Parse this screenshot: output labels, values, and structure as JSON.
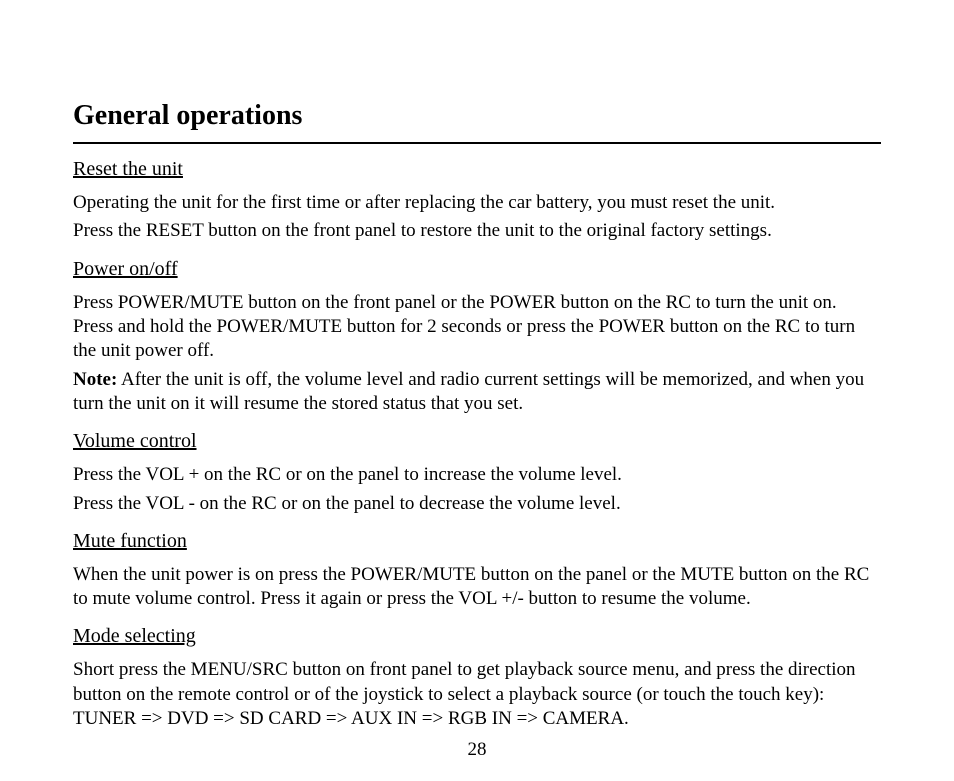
{
  "title": "General operations",
  "sections": [
    {
      "heading": "Reset the unit",
      "paragraphs": [
        "Operating the unit for the first time or after replacing the car battery, you must reset the unit.",
        "Press the RESET button on the front panel to restore the unit to the original factory settings."
      ]
    },
    {
      "heading": "Power on/off",
      "paragraphs": [
        "Press POWER/MUTE button on the front panel or the POWER button on the RC to turn the unit on. Press and hold the POWER/MUTE button for 2 seconds or press the POWER button on the RC to turn the unit power off."
      ],
      "note_label": "Note:",
      "note_text": " After the unit is off, the volume level and radio current settings will be memorized, and when you turn the unit on it will resume the stored status that you set."
    },
    {
      "heading": "Volume control",
      "paragraphs": [
        "Press the VOL + on the RC or on the panel to increase the volume level.",
        "Press the VOL - on the RC or on the panel to decrease the volume level."
      ]
    },
    {
      "heading": "Mute function",
      "paragraphs": [
        "When the unit power is on press the POWER/MUTE button on the panel or the MUTE button on the RC to mute volume control. Press it again or press the VOL +/- button to resume the volume."
      ]
    },
    {
      "heading": "Mode selecting",
      "paragraphs": [
        "Short press the MENU/SRC button on front panel to get playback source menu, and press the direction button on the remote control or of the joystick to select a playback source (or touch the touch key): TUNER => DVD => SD CARD => AUX IN => RGB IN => CAMERA."
      ]
    }
  ],
  "page_number": "28"
}
